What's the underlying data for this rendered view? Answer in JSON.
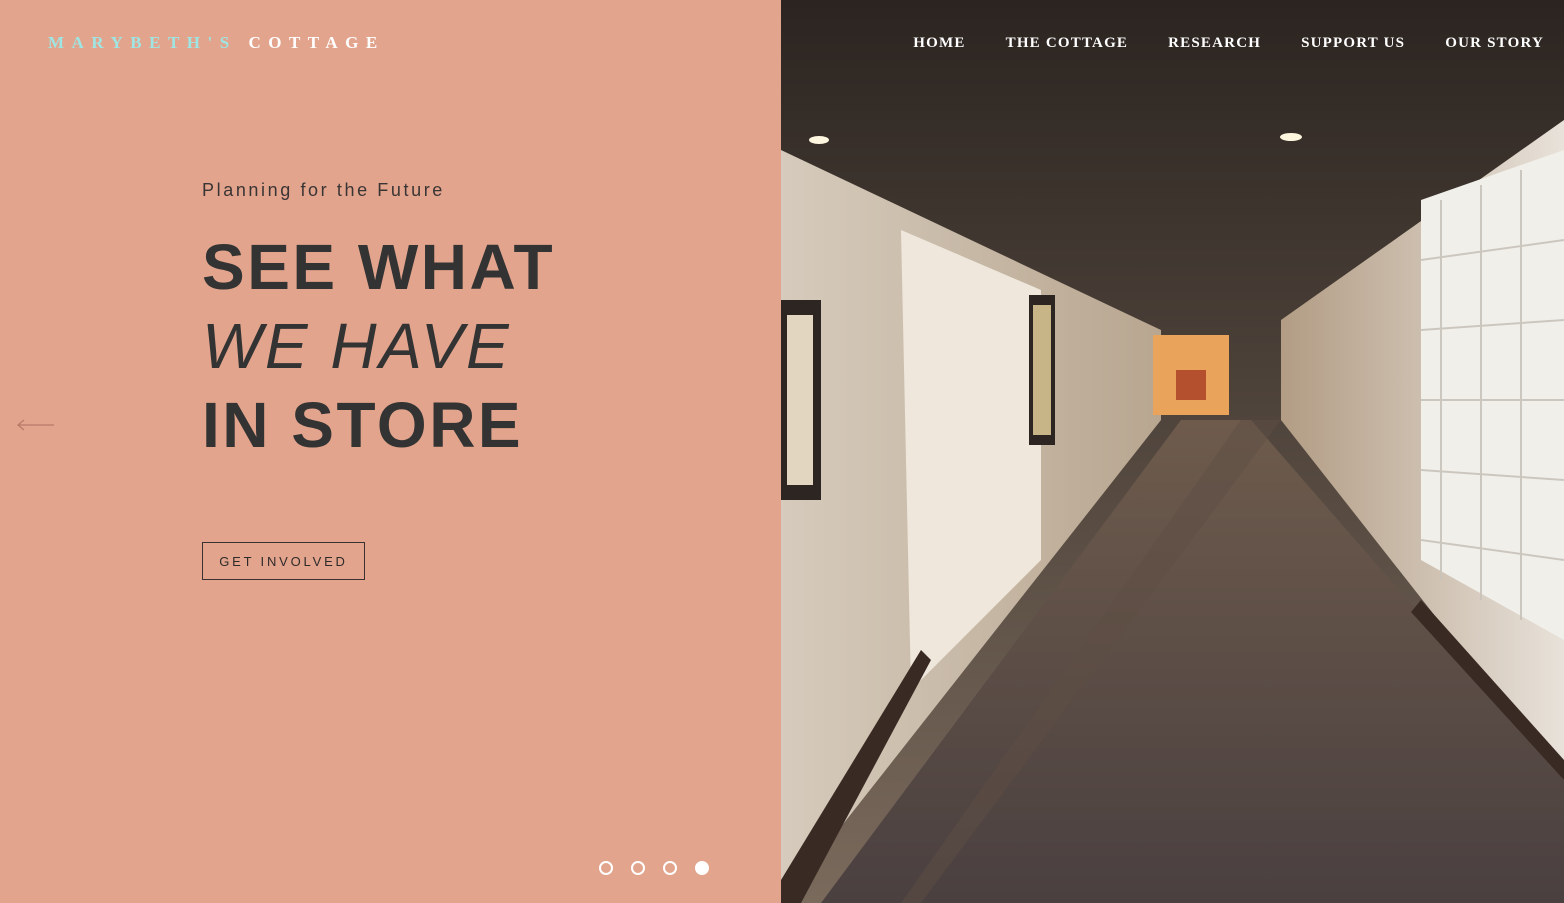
{
  "brand": {
    "part1": "MARYBETH'S",
    "part2": "COTTAGE"
  },
  "nav": {
    "items": [
      "HOME",
      "THE COTTAGE",
      "RESEARCH",
      "SUPPORT US",
      "OUR STORY"
    ]
  },
  "hero": {
    "eyebrow": "Planning for the Future",
    "line1": "SEE WHAT",
    "line2": "WE HAVE",
    "line3": "IN STORE",
    "cta_label": "GET INVOLVED"
  },
  "slider": {
    "slide_count": 4,
    "active_index": 3
  },
  "icons": {
    "prev": "arrow-left-icon"
  },
  "colors": {
    "panel": "#e2a48c",
    "brand_accent": "#9ee5e3",
    "text_dark": "#333333"
  }
}
